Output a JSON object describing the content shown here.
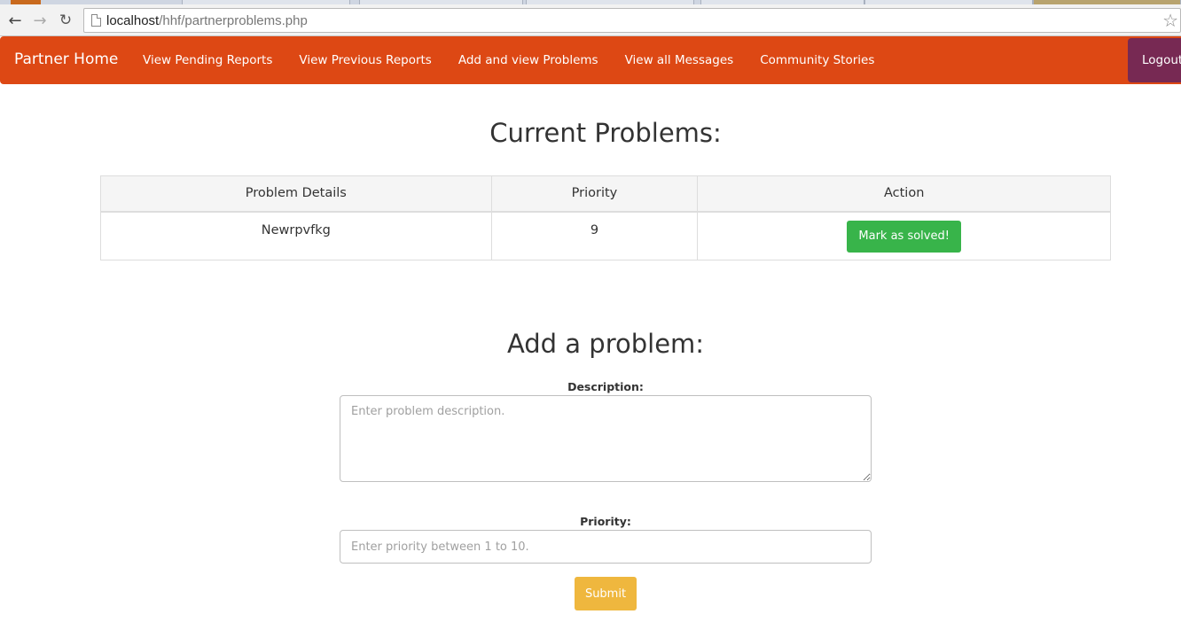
{
  "browser": {
    "url_host": "localhost",
    "url_path": "/hhf/partnerproblems.php"
  },
  "navbar": {
    "brand": "Partner Home",
    "links": [
      "View Pending Reports",
      "View Previous Reports",
      "Add and view Problems",
      "View all Messages",
      "Community Stories"
    ],
    "logout_label": "Logout",
    "color": "#dd4814",
    "logout_color": "#772953"
  },
  "current_problems": {
    "heading": "Current Problems:",
    "columns": [
      "Problem Details",
      "Priority",
      "Action"
    ],
    "rows": [
      {
        "details": "Newrpvfkg",
        "priority": "9",
        "action_label": "Mark as solved!"
      }
    ]
  },
  "add_problem": {
    "heading": "Add a problem:",
    "description_label": "Description:",
    "description_placeholder": "Enter problem description.",
    "description_value": "",
    "priority_label": "Priority:",
    "priority_placeholder": "Enter priority between 1 to 10.",
    "priority_value": "",
    "submit_label": "Submit",
    "submit_color": "#efb73e"
  },
  "icons": {
    "back": "arrow-left-icon",
    "forward": "arrow-right-icon",
    "reload": "reload-icon",
    "page": "page-icon",
    "bookmark": "star-icon"
  }
}
